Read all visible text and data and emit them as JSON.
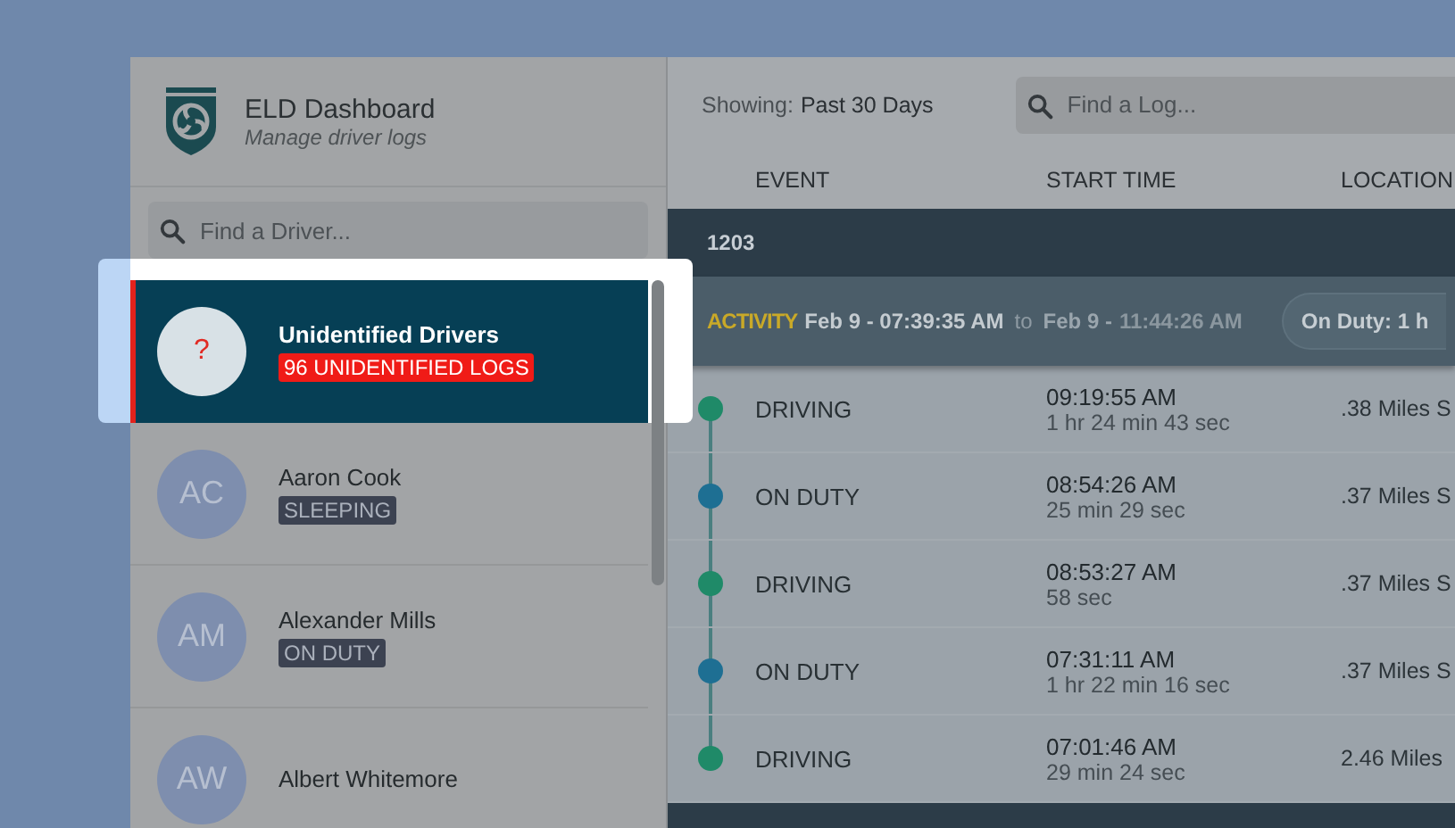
{
  "sidebar": {
    "title": "ELD Dashboard",
    "subtitle": "Manage driver logs",
    "search": {
      "placeholder": "Find a Driver..."
    },
    "drivers": [
      {
        "kind": "unidentified",
        "avatar": "?",
        "name": "Unidentified Drivers",
        "badge": "96 UNIDENTIFIED LOGS",
        "selected": true
      },
      {
        "kind": "driver",
        "avatar": "AC",
        "name": "Aaron Cook",
        "badge": "SLEEPING",
        "selected": false
      },
      {
        "kind": "driver",
        "avatar": "AM",
        "name": "Alexander Mills",
        "badge": "ON DUTY",
        "selected": false
      },
      {
        "kind": "driver",
        "avatar": "AW",
        "name": "Albert Whitemore",
        "selected": false
      }
    ]
  },
  "main": {
    "showing_label": "Showing:",
    "showing_value": "Past 30 Days",
    "search": {
      "placeholder": "Find a Log..."
    },
    "columns": [
      "EVENT",
      "START TIME",
      "LOCATION"
    ],
    "group": {
      "title": "1203",
      "activity": {
        "label": "ACTIVITY",
        "start": "Feb 9 - 07:39:35 AM",
        "to": "to",
        "end_date": "Feb 9 -",
        "end_time": "11:44:26 AM",
        "pill": "On Duty: 1 h"
      }
    },
    "rows": [
      {
        "event": "DRIVING",
        "color": "#1f8a68",
        "time": "09:19:55 AM",
        "duration": "1 hr 24 min 43 sec",
        "location": ".38 Miles S"
      },
      {
        "event": "ON DUTY",
        "color": "#1e6f93",
        "time": "08:54:26 AM",
        "duration": "25 min 29 sec",
        "location": ".37 Miles S"
      },
      {
        "event": "DRIVING",
        "color": "#1f8a68",
        "time": "08:53:27 AM",
        "duration": "58 sec",
        "location": ".37 Miles S"
      },
      {
        "event": "ON DUTY",
        "color": "#1e6f93",
        "time": "07:31:11 AM",
        "duration": "1 hr 22 min 16 sec",
        "location": ".37 Miles S"
      },
      {
        "event": "DRIVING",
        "color": "#1f8a68",
        "time": "07:01:46 AM",
        "duration": "29 min 24 sec",
        "location": "2.46 Miles"
      }
    ]
  }
}
